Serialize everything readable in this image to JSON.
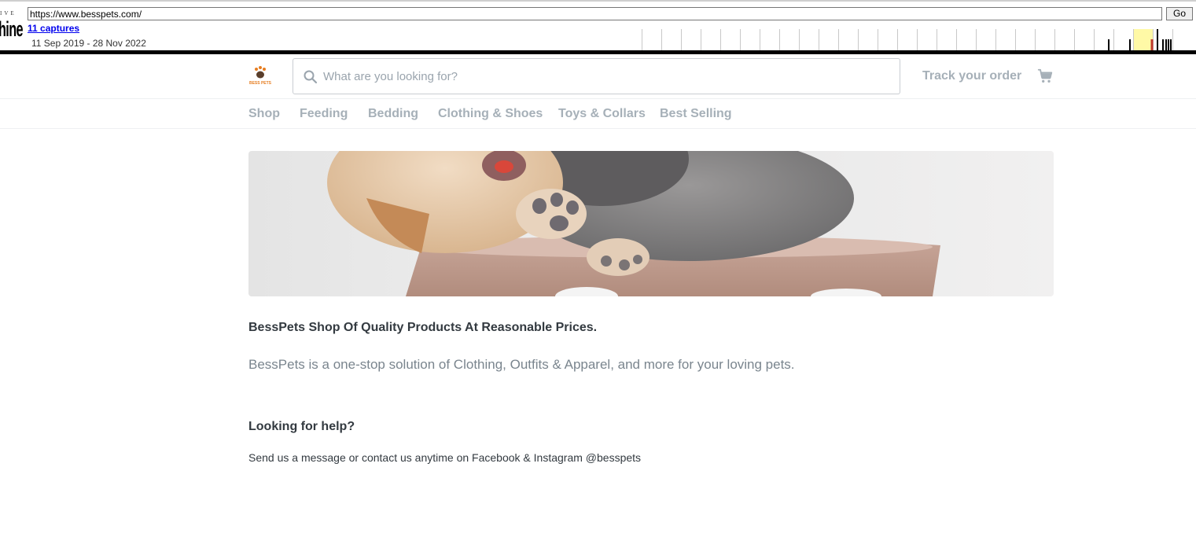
{
  "wayback": {
    "logo_top": "IVE",
    "logo_bottom": "hine",
    "url": "https://www.besspets.com/",
    "go_label": "Go",
    "captures_label": "11 captures",
    "date_range": "11 Sep 2019 - 28 Nov 2022"
  },
  "header": {
    "logo_text": "BESS PETS",
    "search_placeholder": "What are you looking for?",
    "track_order_label": "Track your order",
    "cart_icon": "cart-icon",
    "search_icon": "search-icon"
  },
  "nav": {
    "items": [
      {
        "label": "Shop"
      },
      {
        "label": "Feeding"
      },
      {
        "label": "Bedding"
      },
      {
        "label": "Clothing & Shoes"
      },
      {
        "label": "Toys & Collars"
      },
      {
        "label": "Best Selling"
      }
    ]
  },
  "content": {
    "headline": "BessPets Shop Of Quality Products At Reasonable Prices.",
    "description": "BessPets is a one-stop solution of Clothing, Outfits & Apparel, and more for your loving pets.",
    "help_title": "Looking for help?",
    "help_text": "Send us a message or contact us anytime on Facebook & Instagram @besspets"
  },
  "colors": {
    "accent": "#e67e22",
    "muted_text": "#a6b0b8",
    "body_text": "#333a40"
  }
}
